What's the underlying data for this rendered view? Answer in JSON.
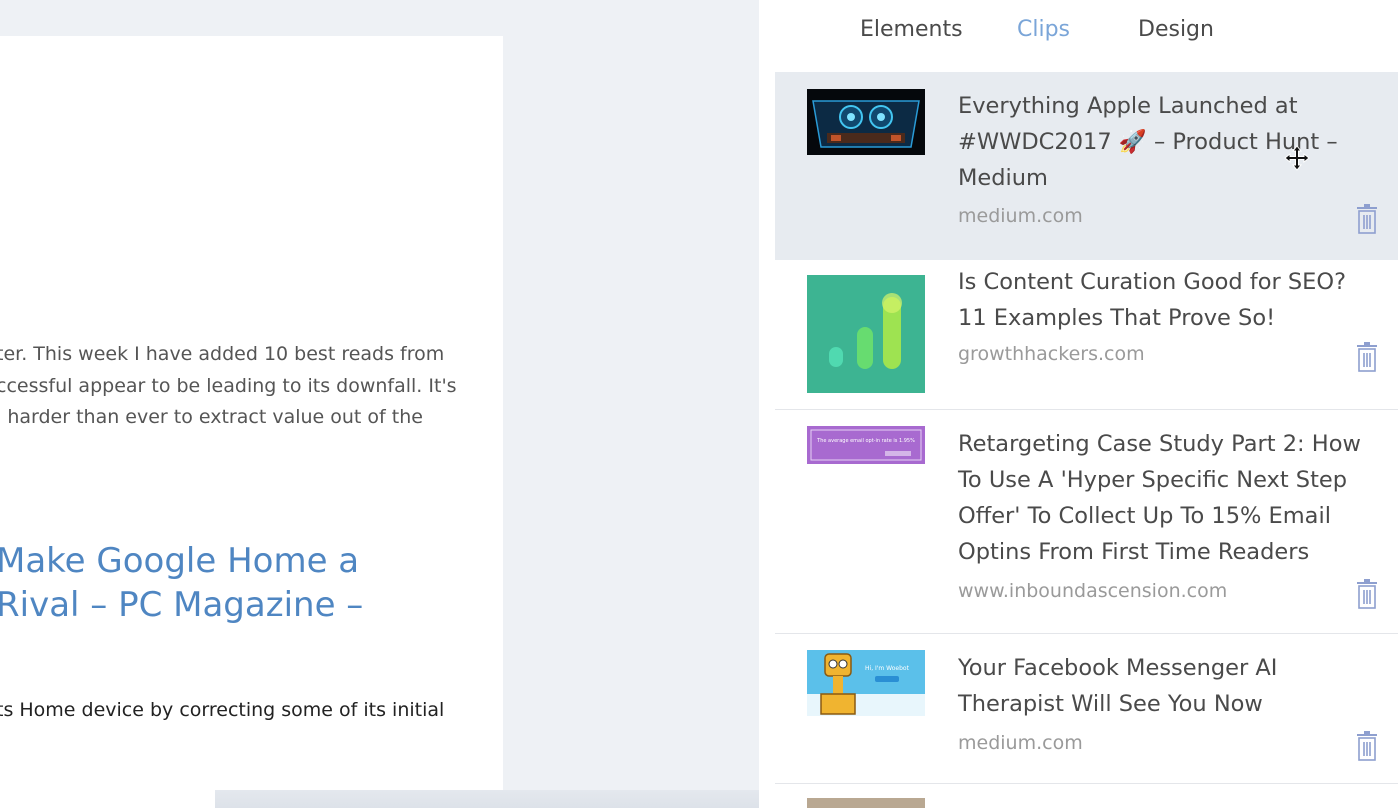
{
  "document": {
    "paragraph1": [
      "ter. This week I have added 10 best reads from",
      "ccessful appear to be leading to its downfall. It's",
      "l harder than ever to extract value out of the"
    ],
    "heading": [
      "Make Google Home a",
      "Rival – PC Magazine –"
    ],
    "paragraph2": [
      "ts Home device by correcting some of its initial"
    ]
  },
  "panel": {
    "tabs": [
      {
        "label": "Elements",
        "active": false
      },
      {
        "label": "Clips",
        "active": true
      },
      {
        "label": "Design",
        "active": false
      }
    ],
    "clips": [
      {
        "title": "Everything Apple Launched at #WWDC2017 🚀 – Product Hunt – Medium",
        "domain": "medium.com",
        "selected": true,
        "thumb": "apple-event-thumbnail"
      },
      {
        "title": "Is Content Curation Good for SEO? 11 Examples That Prove So!",
        "domain": "growthhackers.com",
        "selected": false,
        "thumb": "bar-growth-thumbnail"
      },
      {
        "title": "Retargeting Case Study Part 2: How To Use A 'Hyper Specific Next Step Offer' To Collect Up To 15% Email Optins From First Time Readers",
        "domain": "www.inboundascension.com",
        "selected": false,
        "thumb": "purple-banner-thumbnail",
        "thumb_text": "The average email opt-in rate is 1.95%"
      },
      {
        "title": "Your Facebook Messenger AI Therapist Will See You Now",
        "domain": "medium.com",
        "selected": false,
        "thumb": "woebot-thumbnail",
        "thumb_text": "Hi, I'm Woebot"
      }
    ]
  },
  "colors": {
    "accent": "#7aa5d8",
    "heading_link": "#4f86c2",
    "selected_row": "#e7ebf0",
    "trash_icon": "#8e9fcf"
  },
  "icons": [
    "trash-icon",
    "move-cursor-icon"
  ]
}
